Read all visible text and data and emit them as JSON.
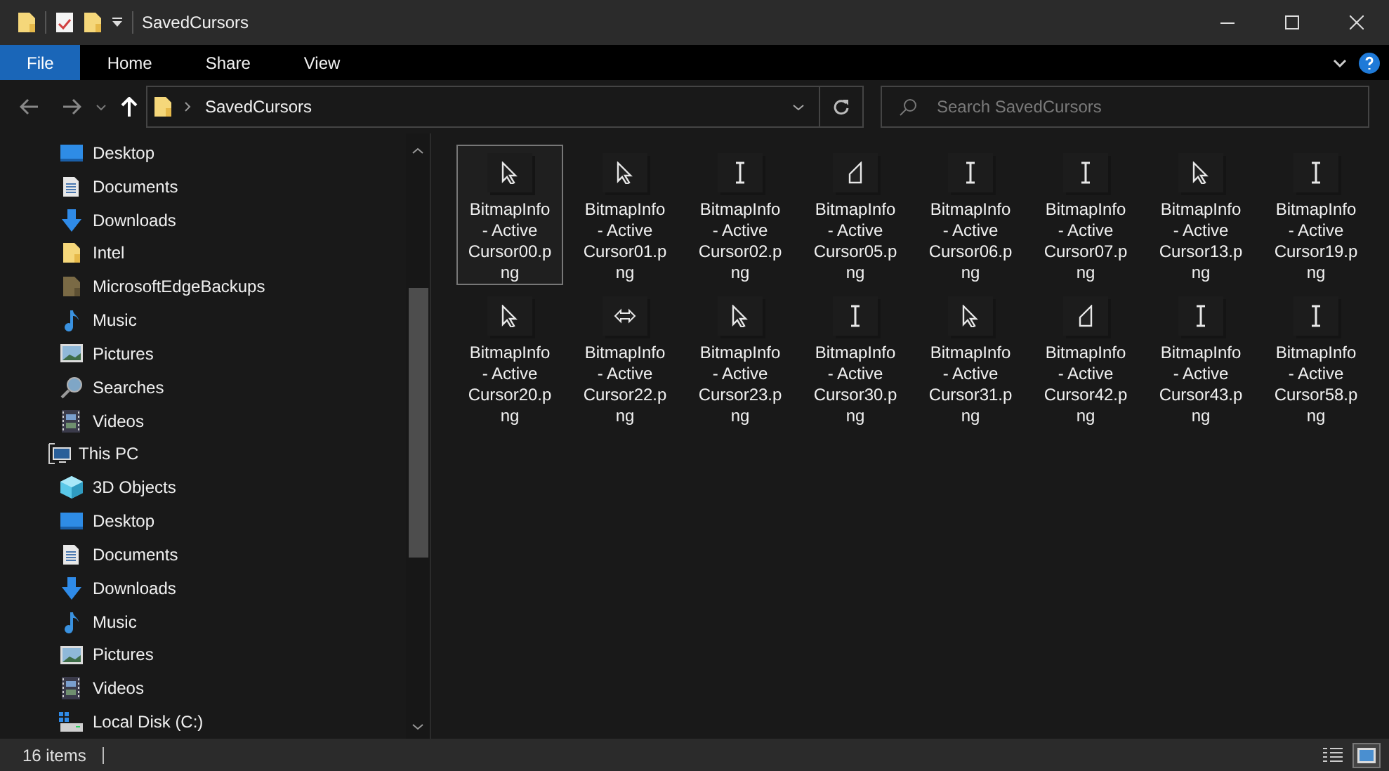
{
  "window": {
    "title": "SavedCursors"
  },
  "ribbon": {
    "tabs": [
      {
        "label": "File",
        "selected": true
      },
      {
        "label": "Home",
        "selected": false
      },
      {
        "label": "Share",
        "selected": false
      },
      {
        "label": "View",
        "selected": false
      }
    ]
  },
  "address": {
    "path": "SavedCursors"
  },
  "search": {
    "placeholder": "Search SavedCursors"
  },
  "sidebar": {
    "quick_access_items": [
      {
        "label": "Desktop",
        "kind": "desktop"
      },
      {
        "label": "Documents",
        "kind": "documents"
      },
      {
        "label": "Downloads",
        "kind": "downloads"
      },
      {
        "label": "Intel",
        "kind": "folder"
      },
      {
        "label": "MicrosoftEdgeBackups",
        "kind": "folder-dark"
      },
      {
        "label": "Music",
        "kind": "music"
      },
      {
        "label": "Pictures",
        "kind": "pictures"
      },
      {
        "label": "Searches",
        "kind": "searches"
      },
      {
        "label": "Videos",
        "kind": "videos"
      }
    ],
    "this_pc": {
      "label": "This PC",
      "children": [
        {
          "label": "3D Objects",
          "kind": "objects"
        },
        {
          "label": "Desktop",
          "kind": "desktop"
        },
        {
          "label": "Documents",
          "kind": "documents"
        },
        {
          "label": "Downloads",
          "kind": "downloads"
        },
        {
          "label": "Music",
          "kind": "music"
        },
        {
          "label": "Pictures",
          "kind": "pictures"
        },
        {
          "label": "Videos",
          "kind": "videos"
        },
        {
          "label": "Local Disk (C:)",
          "kind": "disk"
        }
      ]
    }
  },
  "files": [
    {
      "name": "BitmapInfo - Active Cursor00.png",
      "kind": "arrow",
      "selected": true
    },
    {
      "name": "BitmapInfo - Active Cursor01.png",
      "kind": "arrow",
      "selected": false
    },
    {
      "name": "BitmapInfo - Active Cursor02.png",
      "kind": "ibeam",
      "selected": false
    },
    {
      "name": "BitmapInfo - Active Cursor05.png",
      "kind": "pen",
      "selected": false
    },
    {
      "name": "BitmapInfo - Active Cursor06.png",
      "kind": "ibeam",
      "selected": false
    },
    {
      "name": "BitmapInfo - Active Cursor07.png",
      "kind": "ibeam",
      "selected": false
    },
    {
      "name": "BitmapInfo - Active Cursor13.png",
      "kind": "arrow",
      "selected": false
    },
    {
      "name": "BitmapInfo - Active Cursor19.png",
      "kind": "ibeam",
      "selected": false
    },
    {
      "name": "BitmapInfo - Active Cursor20.png",
      "kind": "arrow",
      "selected": false
    },
    {
      "name": "BitmapInfo - Active Cursor22.png",
      "kind": "resize",
      "selected": false
    },
    {
      "name": "BitmapInfo - Active Cursor23.png",
      "kind": "arrow",
      "selected": false
    },
    {
      "name": "BitmapInfo - Active Cursor30.png",
      "kind": "ibeam",
      "selected": false
    },
    {
      "name": "BitmapInfo - Active Cursor31.png",
      "kind": "arrow",
      "selected": false
    },
    {
      "name": "BitmapInfo - Active Cursor42.png",
      "kind": "pen",
      "selected": false
    },
    {
      "name": "BitmapInfo - Active Cursor43.png",
      "kind": "ibeam",
      "selected": false
    },
    {
      "name": "BitmapInfo - Active Cursor58.png",
      "kind": "ibeam",
      "selected": false
    }
  ],
  "status_bar": {
    "item_count": "16 items",
    "view_buttons": [
      {
        "kind": "details",
        "selected": false
      },
      {
        "kind": "large-icons",
        "selected": true
      }
    ]
  }
}
